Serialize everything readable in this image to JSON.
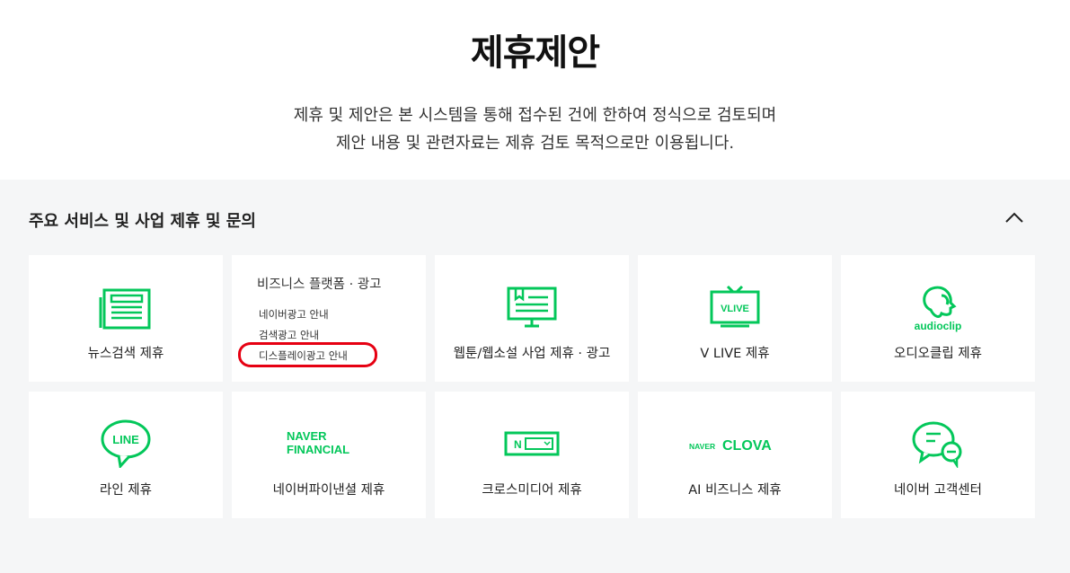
{
  "header": {
    "title": "제휴제안",
    "description_line1": "제휴 및 제안은 본 시스템을 통해 접수된 건에 한하여 정식으로 검토되며",
    "description_line2": "제안 내용 및 관련자료는 제휴 검토 목적으로만 이용됩니다."
  },
  "section": {
    "title": "주요 서비스 및 사업 제휴 및 문의",
    "collapse_icon": "chevron-up-icon"
  },
  "colors": {
    "accent": "#03c75a",
    "highlight": "#e60012",
    "panel_bg": "#f5f6f7"
  },
  "cards": {
    "news": {
      "label": "뉴스검색 제휴",
      "icon": "newspaper-icon"
    },
    "business": {
      "title": "비즈니스 플랫폼 · 광고",
      "links": [
        "네이버광고 안내",
        "검색광고 안내",
        "디스플레이광고 안내"
      ]
    },
    "webtoon": {
      "label": "웹툰/웹소설 사업 제휴 · 광고",
      "icon": "monitor-book-icon"
    },
    "vlive": {
      "label": "V LIVE 제휴",
      "icon": "vlive-tv-icon",
      "logo_text": "VLIVE"
    },
    "audioclip": {
      "label": "오디오클립 제휴",
      "icon": "audioclip-icon",
      "logo_text": "audioclip"
    },
    "line": {
      "label": "라인 제휴",
      "icon": "line-bubble-icon",
      "logo_text": "LINE"
    },
    "financial": {
      "label": "네이버파이낸셜 제휴",
      "logo_line1": "NAVER",
      "logo_line2": "FINANCIAL"
    },
    "crossmedia": {
      "label": "크로스미디어 제휴",
      "icon": "crossmedia-icon",
      "logo_text": "N"
    },
    "clova": {
      "label": "AI 비즈니스 제휴",
      "logo_small": "NAVER",
      "logo_big": "CLOVA"
    },
    "cs": {
      "label": "네이버 고객센터",
      "icon": "chat-bubbles-icon"
    }
  }
}
